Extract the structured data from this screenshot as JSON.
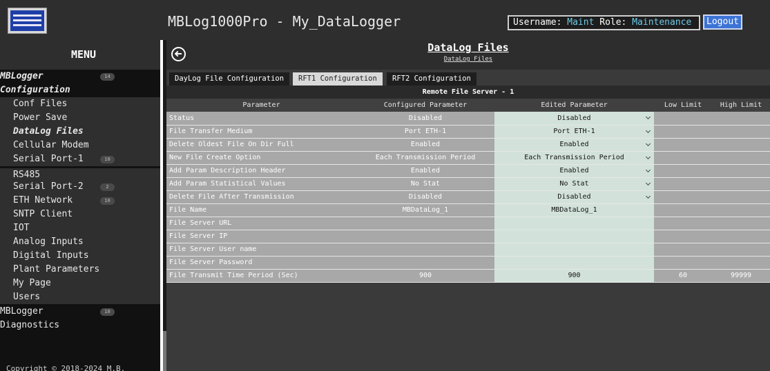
{
  "header": {
    "app_title": "MBLog1000Pro - My_DataLogger",
    "username_label": "Username:",
    "username": "Maint",
    "role_label": "Role:",
    "role": "Maintenance",
    "logout_label": "Logout"
  },
  "sidebar": {
    "title": "MENU",
    "items": [
      {
        "label": "MBLogger",
        "badge": "14",
        "kind": "group"
      },
      {
        "label": "Configuration",
        "kind": "group"
      },
      {
        "label": "Conf Files",
        "kind": "sub"
      },
      {
        "label": "Power Save",
        "kind": "sub"
      },
      {
        "label": "DataLog Files",
        "kind": "sub",
        "active": true
      },
      {
        "label": "Cellular Modem",
        "kind": "sub"
      },
      {
        "label": "Serial Port-1",
        "badge": "10",
        "kind": "sub"
      },
      {
        "label": "RS485",
        "kind": "sub"
      },
      {
        "label": "Serial Port-2",
        "badge": "2",
        "kind": "sub"
      },
      {
        "label": "ETH Network",
        "badge": "10",
        "kind": "sub"
      },
      {
        "label": "SNTP Client",
        "kind": "sub"
      },
      {
        "label": "IOT",
        "kind": "sub"
      },
      {
        "label": "Analog Inputs",
        "kind": "sub"
      },
      {
        "label": "Digital Inputs",
        "kind": "sub"
      },
      {
        "label": "Plant Parameters",
        "kind": "sub"
      },
      {
        "label": "My Page",
        "kind": "sub"
      },
      {
        "label": "Users",
        "kind": "sub"
      },
      {
        "label": "MBLogger",
        "badge": "10",
        "kind": "group2"
      },
      {
        "label": "Diagnostics",
        "kind": "group2"
      }
    ],
    "copyright": "Copyright © 2018-2024 M.B."
  },
  "main": {
    "page_title": "DataLog Files",
    "breadcrumb": "DataLog Files",
    "tabs": [
      {
        "label": "DayLog File Configuration",
        "active": false
      },
      {
        "label": "RFT1 Configuration",
        "active": true
      },
      {
        "label": "RFT2 Configuration",
        "active": false
      }
    ],
    "section_title": "Remote File Server - 1",
    "columns": [
      "Parameter",
      "Configured Parameter",
      "Edited Parameter",
      "Low Limit",
      "High Limit"
    ],
    "rows": [
      {
        "name": "Status",
        "configured": "Disabled",
        "edited": "Disabled",
        "select": true,
        "low": "",
        "high": ""
      },
      {
        "name": "File Transfer Medium",
        "configured": "Port ETH-1",
        "edited": "Port ETH-1",
        "select": true,
        "low": "",
        "high": ""
      },
      {
        "name": "Delete Oldest File On Dir Full",
        "configured": "Enabled",
        "edited": "Enabled",
        "select": true,
        "low": "",
        "high": ""
      },
      {
        "name": "New File Create Option",
        "configured": "Each Transmission Period",
        "edited": "Each Transmission Period",
        "select": true,
        "low": "",
        "high": ""
      },
      {
        "name": "Add Param Description Header",
        "configured": "Enabled",
        "edited": "Enabled",
        "select": true,
        "low": "",
        "high": ""
      },
      {
        "name": "Add Param Statistical Values",
        "configured": "No Stat",
        "edited": "No Stat",
        "select": true,
        "low": "",
        "high": ""
      },
      {
        "name": "Delete File After Transmission",
        "configured": "Disabled",
        "edited": "Disabled",
        "select": true,
        "low": "",
        "high": ""
      },
      {
        "name": "File Name",
        "configured": "MBDataLog_1",
        "edited": "MBDataLog_1",
        "select": false,
        "low": "",
        "high": ""
      },
      {
        "name": "File Server URL",
        "configured": "",
        "edited": "",
        "select": false,
        "low": "",
        "high": ""
      },
      {
        "name": "File Server IP",
        "configured": "",
        "edited": "",
        "select": false,
        "low": "",
        "high": ""
      },
      {
        "name": "File Server User name",
        "configured": "",
        "edited": "",
        "select": false,
        "low": "",
        "high": ""
      },
      {
        "name": "File Server Password",
        "configured": "",
        "edited": "",
        "select": false,
        "low": "",
        "high": ""
      },
      {
        "name": "File Transmit Time Period (Sec)",
        "configured": "900",
        "edited": "900",
        "select": false,
        "low": "60",
        "high": "99999"
      }
    ]
  }
}
